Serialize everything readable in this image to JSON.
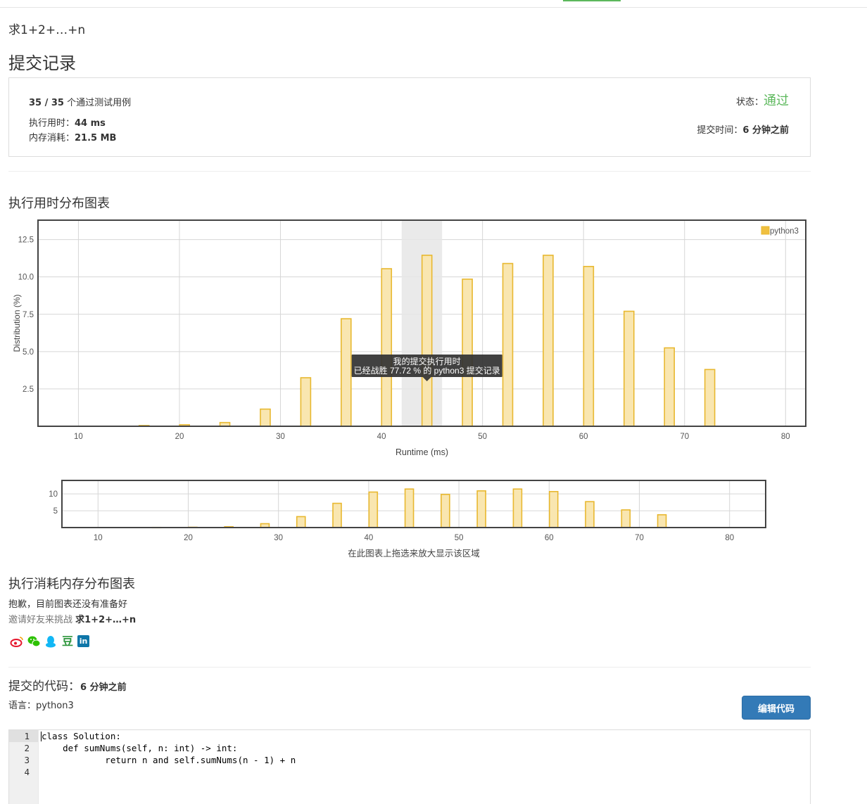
{
  "problem": {
    "title": "求1+2+…+n"
  },
  "page": {
    "title": "提交记录"
  },
  "result": {
    "cases_passed": "35 / 35",
    "cases_label": " 个通过测试用例",
    "runtime_label": "执行用时：",
    "runtime_value": "44 ms",
    "memory_label": "内存消耗：",
    "memory_value": "21.5 MB",
    "status_label": "状态：",
    "status_value": "通过",
    "submit_time_label": "提交时间：",
    "submit_time_value": "6 分钟之前"
  },
  "runtime_chart_title": "执行用时分布图表",
  "memory_chart_title": "执行消耗内存分布图表",
  "memory_not_ready": "抱歉，目前图表还没有准备好",
  "invite_prefix": "邀请好友来挑战 ",
  "invite_problem": "求1+2+…+n",
  "share_icons": [
    "weibo-icon",
    "wechat-icon",
    "qq-icon",
    "douban-icon",
    "linkedin-icon"
  ],
  "share_glyphs": {
    "douban": "豆",
    "linkedin": "in"
  },
  "code_section": {
    "title": "提交的代码：",
    "time": "6 分钟之前",
    "language_label": "语言：",
    "language": "python3",
    "edit_button": "编辑代码",
    "line_numbers": [
      "1",
      "2",
      "3",
      "4"
    ],
    "lines": [
      "class Solution:",
      "    def sumNums(self, n: int) -> int:",
      "            return n and self.sumNums(n - 1) + n",
      ""
    ]
  },
  "colors": {
    "bar_fill": "#f9e6b0",
    "bar_stroke": "#e8b830",
    "status_ok": "#5cb85c",
    "button": "#337ab7",
    "highlight_band": "#e6e6e6"
  },
  "chart_data": [
    {
      "type": "bar",
      "xlabel": "Runtime (ms)",
      "ylabel": "Distribution (%)",
      "xlim": [
        6,
        82
      ],
      "ylim": [
        0,
        13.8
      ],
      "x_ticks": [
        10,
        20,
        30,
        40,
        50,
        60,
        70,
        80
      ],
      "y_ticks": [
        2.5,
        5.0,
        7.5,
        10.0,
        12.5
      ],
      "y_tick_labels": [
        "2.5",
        "5.0",
        "7.5",
        "10.0",
        "12.5"
      ],
      "grid": true,
      "legend_position": "top-right",
      "highlight_range": [
        42,
        46
      ],
      "series": [
        {
          "name": "python3",
          "x": [
            16.5,
            20.5,
            24.5,
            28.5,
            32.5,
            36.5,
            40.5,
            44.5,
            48.5,
            52.5,
            56.5,
            60.5,
            64.5,
            68.5,
            72.5
          ],
          "values": [
            0.05,
            0.1,
            0.25,
            1.15,
            3.25,
            7.2,
            10.55,
            11.45,
            9.85,
            10.9,
            11.45,
            10.7,
            7.7,
            5.25,
            3.8
          ]
        }
      ],
      "tooltip": {
        "line1": "我的提交执行用时",
        "line2": "已经战胜 77.72 % 的 python3 提交记录"
      }
    },
    {
      "type": "bar",
      "xlabel": "在此图表上拖选来放大显示该区域",
      "xlim": [
        6,
        84
      ],
      "ylim": [
        0,
        14
      ],
      "x_ticks": [
        10,
        20,
        30,
        40,
        50,
        60,
        70,
        80
      ],
      "y_ticks": [
        5,
        10
      ],
      "y_tick_labels": [
        "5",
        "10"
      ],
      "grid": true,
      "series": [
        {
          "x": [
            16.5,
            20.5,
            24.5,
            28.5,
            32.5,
            36.5,
            40.5,
            44.5,
            48.5,
            52.5,
            56.5,
            60.5,
            64.5,
            68.5,
            72.5
          ],
          "values": [
            0.05,
            0.1,
            0.25,
            1.15,
            3.25,
            7.2,
            10.55,
            11.45,
            9.85,
            10.9,
            11.45,
            10.7,
            7.7,
            5.25,
            3.8
          ]
        }
      ]
    }
  ]
}
